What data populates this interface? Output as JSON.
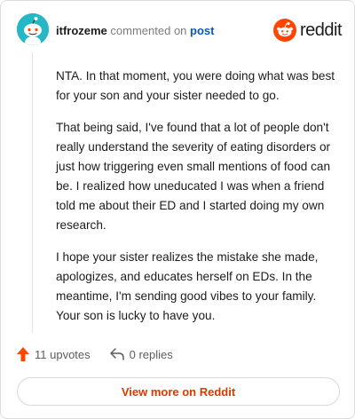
{
  "comment": {
    "username": "itfrozeme",
    "action_text": "commented on",
    "post_link": "post",
    "paragraphs": [
      "NTA. In that moment, you were doing what was best for your son and your sister needed to go.",
      "That being said, I've found that a lot of people don't really understand the severity of eating disorders or just how triggering even small mentions of food can be. I realized how uneducated I was when a friend told me about their ED and I started doing my own research.",
      "I hope your sister realizes the mistake she made, apologizes, and educates herself on EDs. In the meantime, I'm sending good vibes to your family. Your son is lucky to have you."
    ]
  },
  "brand": {
    "name": "reddit",
    "color": "#ff4500"
  },
  "actions": {
    "upvotes": "11 upvotes",
    "replies": "0 replies"
  },
  "footer": {
    "view_more": "View more on Reddit"
  },
  "colors": {
    "accent": "#d93a00",
    "link": "#0a59b5",
    "upvote": "#ff4500",
    "avatar_bg": "#24b7c6"
  },
  "icons": {
    "avatar": "snoo-avatar-icon",
    "brand": "reddit-logo-icon",
    "upvote": "upvote-arrow-icon",
    "reply": "reply-arrow-icon"
  }
}
